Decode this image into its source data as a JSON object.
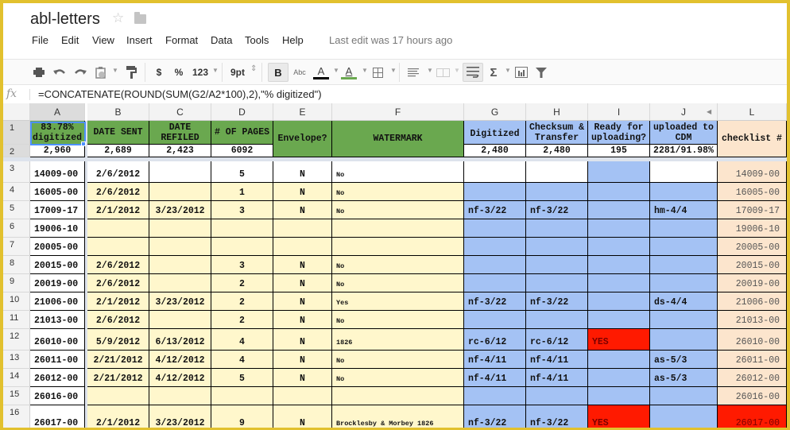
{
  "app": {
    "title": "abl-letters",
    "last_edit": "Last edit was 17 hours ago"
  },
  "menu": [
    "File",
    "Edit",
    "View",
    "Insert",
    "Format",
    "Data",
    "Tools",
    "Help"
  ],
  "toolbar": {
    "currency": "$",
    "percent": "%",
    "number_format": "123",
    "font_size": "9pt",
    "bold": "B",
    "strikethrough": "Abc",
    "text_color_label": "A",
    "fill_color_label": "A",
    "sum": "Σ",
    "text_color": "#000000",
    "fill_color": "#6aa84f"
  },
  "formula_bar": {
    "fx_label": "fx",
    "formula": "=CONCATENATE(ROUND(SUM(G2/A2*100),2),\"% digitized\")"
  },
  "columns": [
    "A",
    "B",
    "C",
    "D",
    "E",
    "F",
    "G",
    "H",
    "I",
    "J",
    "L"
  ],
  "header_row1": {
    "A": "83.78% digitized",
    "B": "DATE SENT",
    "C": "DATE REFILED",
    "D": "# OF PAGES",
    "E": "Envelope?",
    "F": "WATERMARK",
    "G": "Digitized",
    "H": "Checksum & Transfer",
    "I": "Ready for uploading?",
    "J": "uploaded to CDM",
    "L": "checklist #"
  },
  "header_row2": {
    "A": "2,960",
    "B": "2,689",
    "C": "2,423",
    "D": "6092",
    "G": "2,480",
    "H": "2,480",
    "I": "195",
    "J": "2281/91.98%"
  },
  "rows": [
    {
      "num": "3",
      "A": "14009-00",
      "B": "2/6/2012",
      "C": "",
      "D": "5",
      "E": "N",
      "F": "No",
      "G": "",
      "H": "",
      "I": "",
      "J": "",
      "L": "14009-00"
    },
    {
      "num": "4",
      "A": "16005-00",
      "B": "2/6/2012",
      "C": "",
      "D": "1",
      "E": "N",
      "F": "No",
      "G": "",
      "H": "",
      "I": "",
      "J": "",
      "L": "16005-00"
    },
    {
      "num": "5",
      "A": "17009-17",
      "B": "2/1/2012",
      "C": "3/23/2012",
      "D": "3",
      "E": "N",
      "F": "No",
      "G": "nf-3/22",
      "H": "nf-3/22",
      "I": "",
      "J": "hm-4/4",
      "L": "17009-17"
    },
    {
      "num": "6",
      "A": "19006-10",
      "B": "",
      "C": "",
      "D": "",
      "E": "",
      "F": "",
      "G": "",
      "H": "",
      "I": "",
      "J": "",
      "L": "19006-10"
    },
    {
      "num": "7",
      "A": "20005-00",
      "B": "",
      "C": "",
      "D": "",
      "E": "",
      "F": "",
      "G": "",
      "H": "",
      "I": "",
      "J": "",
      "L": "20005-00"
    },
    {
      "num": "8",
      "A": "20015-00",
      "B": "2/6/2012",
      "C": "",
      "D": "3",
      "E": "N",
      "F": "No",
      "G": "",
      "H": "",
      "I": "",
      "J": "",
      "L": "20015-00"
    },
    {
      "num": "9",
      "A": "20019-00",
      "B": "2/6/2012",
      "C": "",
      "D": "2",
      "E": "N",
      "F": "No",
      "G": "",
      "H": "",
      "I": "",
      "J": "",
      "L": "20019-00"
    },
    {
      "num": "10",
      "A": "21006-00",
      "B": "2/1/2012",
      "C": "3/23/2012",
      "D": "2",
      "E": "N",
      "F": "Yes",
      "G": "nf-3/22",
      "H": "nf-3/22",
      "I": "",
      "J": "ds-4/4",
      "L": "21006-00"
    },
    {
      "num": "11",
      "A": "21013-00",
      "B": "2/6/2012",
      "C": "",
      "D": "2",
      "E": "N",
      "F": "No",
      "G": "",
      "H": "",
      "I": "",
      "J": "",
      "L": "21013-00"
    },
    {
      "num": "12",
      "A": "26010-00",
      "B": "5/9/2012",
      "C": "6/13/2012",
      "D": "4",
      "E": "N",
      "F": "1826",
      "G": "rc-6/12",
      "H": "rc-6/12",
      "I": "YES",
      "J": "",
      "L": "26010-00"
    },
    {
      "num": "13",
      "A": "26011-00",
      "B": "2/21/2012",
      "C": "4/12/2012",
      "D": "4",
      "E": "N",
      "F": "No",
      "G": "nf-4/11",
      "H": "nf-4/11",
      "I": "",
      "J": "as-5/3",
      "L": "26011-00"
    },
    {
      "num": "14",
      "A": "26012-00",
      "B": "2/21/2012",
      "C": "4/12/2012",
      "D": "5",
      "E": "N",
      "F": "No",
      "G": "nf-4/11",
      "H": "nf-4/11",
      "I": "",
      "J": "as-5/3",
      "L": "26012-00"
    },
    {
      "num": "15",
      "A": "26016-00",
      "B": "",
      "C": "",
      "D": "",
      "E": "",
      "F": "",
      "G": "",
      "H": "",
      "I": "",
      "J": "",
      "L": "26016-00"
    },
    {
      "num": "16",
      "A": "26017-00",
      "B": "2/1/2012",
      "C": "3/23/2012",
      "D": "9",
      "E": "N",
      "F": "Brocklesby & Morbey 1826",
      "G": "nf-3/22",
      "H": "nf-3/22",
      "I": "YES",
      "J": "",
      "L": "26017-00"
    }
  ],
  "cell_colors": {
    "header_green": "#6aa84f",
    "progress_blue": "#a4c2f4",
    "data_yellow": "#fff7cc",
    "checklist_peach": "#fce5cd",
    "ready_red": "#ff1a00"
  }
}
